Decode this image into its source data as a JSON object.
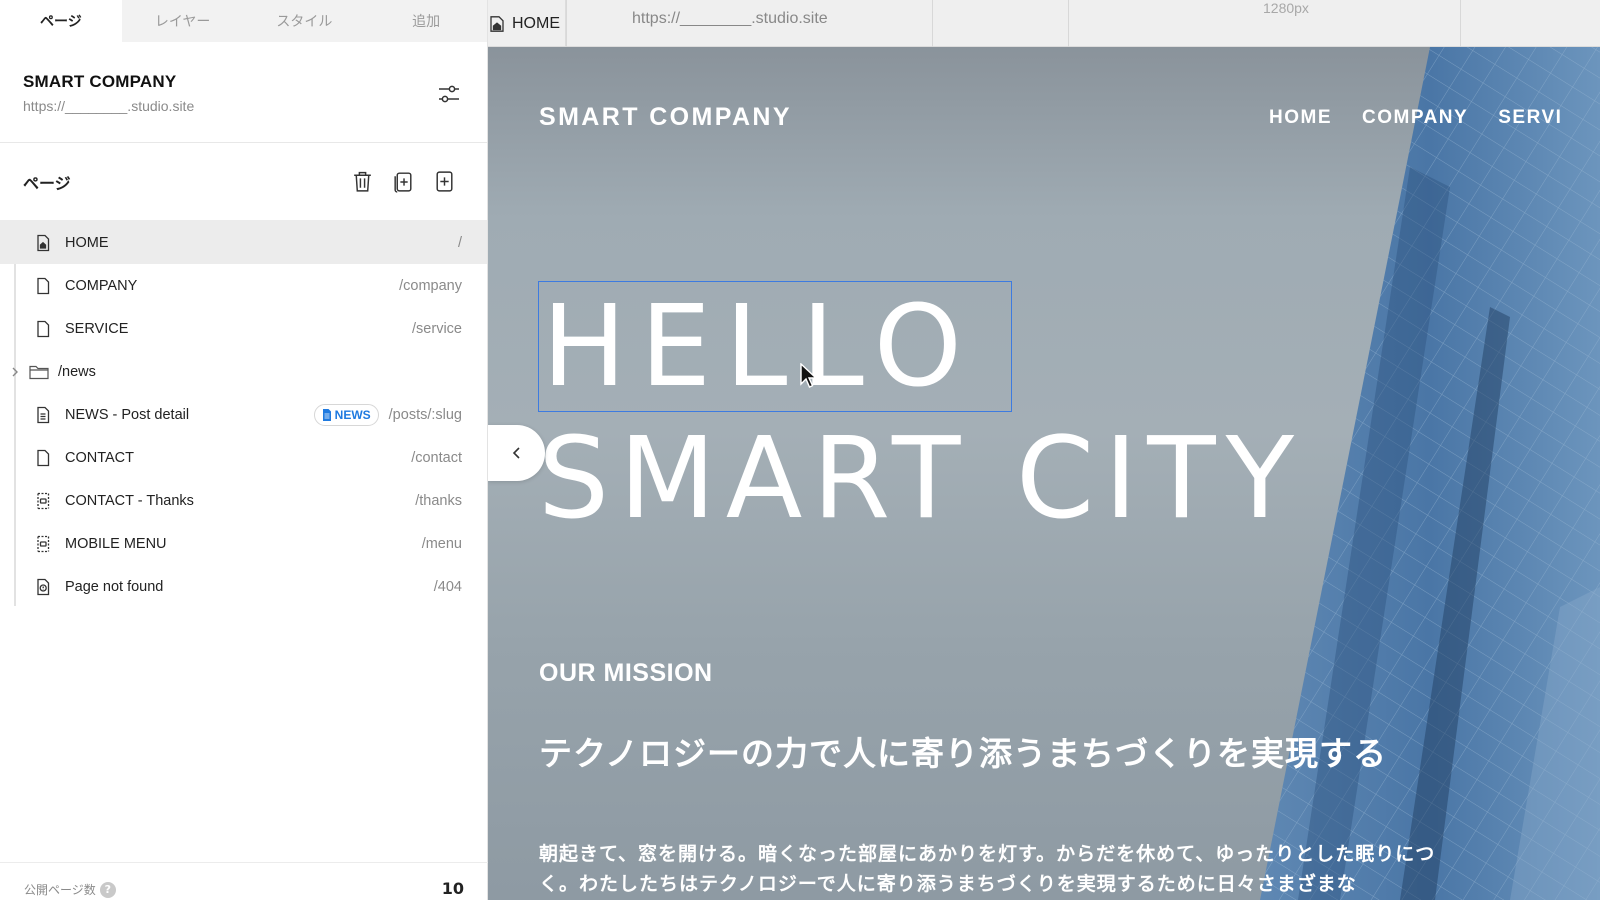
{
  "sidebar": {
    "tabs": [
      {
        "label": "ページ",
        "active": true
      },
      {
        "label": "レイヤー",
        "active": false
      },
      {
        "label": "スタイル",
        "active": false
      },
      {
        "label": "追加",
        "active": false
      }
    ],
    "site": {
      "name": "SMART COMPANY",
      "url": "https://________.studio.site"
    },
    "pages_title": "ページ",
    "pages": [
      {
        "label": "HOME",
        "path": "/",
        "icon": "home-page-icon",
        "selected": true
      },
      {
        "label": "COMPANY",
        "path": "/company",
        "icon": "page-icon"
      },
      {
        "label": "SERVICE",
        "path": "/service",
        "icon": "page-icon"
      },
      {
        "label": "/news",
        "path": "",
        "icon": "folder-icon",
        "folder": true
      },
      {
        "label": "NEWS - Post detail",
        "path": "/posts/:slug",
        "icon": "document-icon",
        "badge": "NEWS"
      },
      {
        "label": "CONTACT",
        "path": "/contact",
        "icon": "page-icon"
      },
      {
        "label": "CONTACT - Thanks",
        "path": "/thanks",
        "icon": "modal-page-icon"
      },
      {
        "label": "MOBILE MENU",
        "path": "/menu",
        "icon": "modal-page-icon"
      },
      {
        "label": "Page not found",
        "path": "/404",
        "icon": "not-found-page-icon"
      }
    ],
    "footer": {
      "label": "公開ページ数",
      "help": "?",
      "count": "10"
    }
  },
  "topbar": {
    "current_page": "HOME",
    "url": "https://________.studio.site",
    "width_label": "1280px"
  },
  "canvas": {
    "brand": "SMART COMPANY",
    "nav": [
      "HOME",
      "COMPANY",
      "SERVI"
    ],
    "hero_line1": "HELLO",
    "hero_line2": "SMART CITY",
    "mission_heading": "OUR MISSION",
    "tagline": "テクノロジーの力で人に寄り添うまちづくりを実現する",
    "body": "朝起きて、窓を開ける。暗くなった部屋にあかりを灯す。からだを休めて、ゆったりとした眠りにつく。わたしたちはテクノロジーで人に寄り添うまちづくりを実現するために日々さまざまな"
  },
  "colors": {
    "accent": "#1f7ae0",
    "selection": "#3d7be0"
  }
}
